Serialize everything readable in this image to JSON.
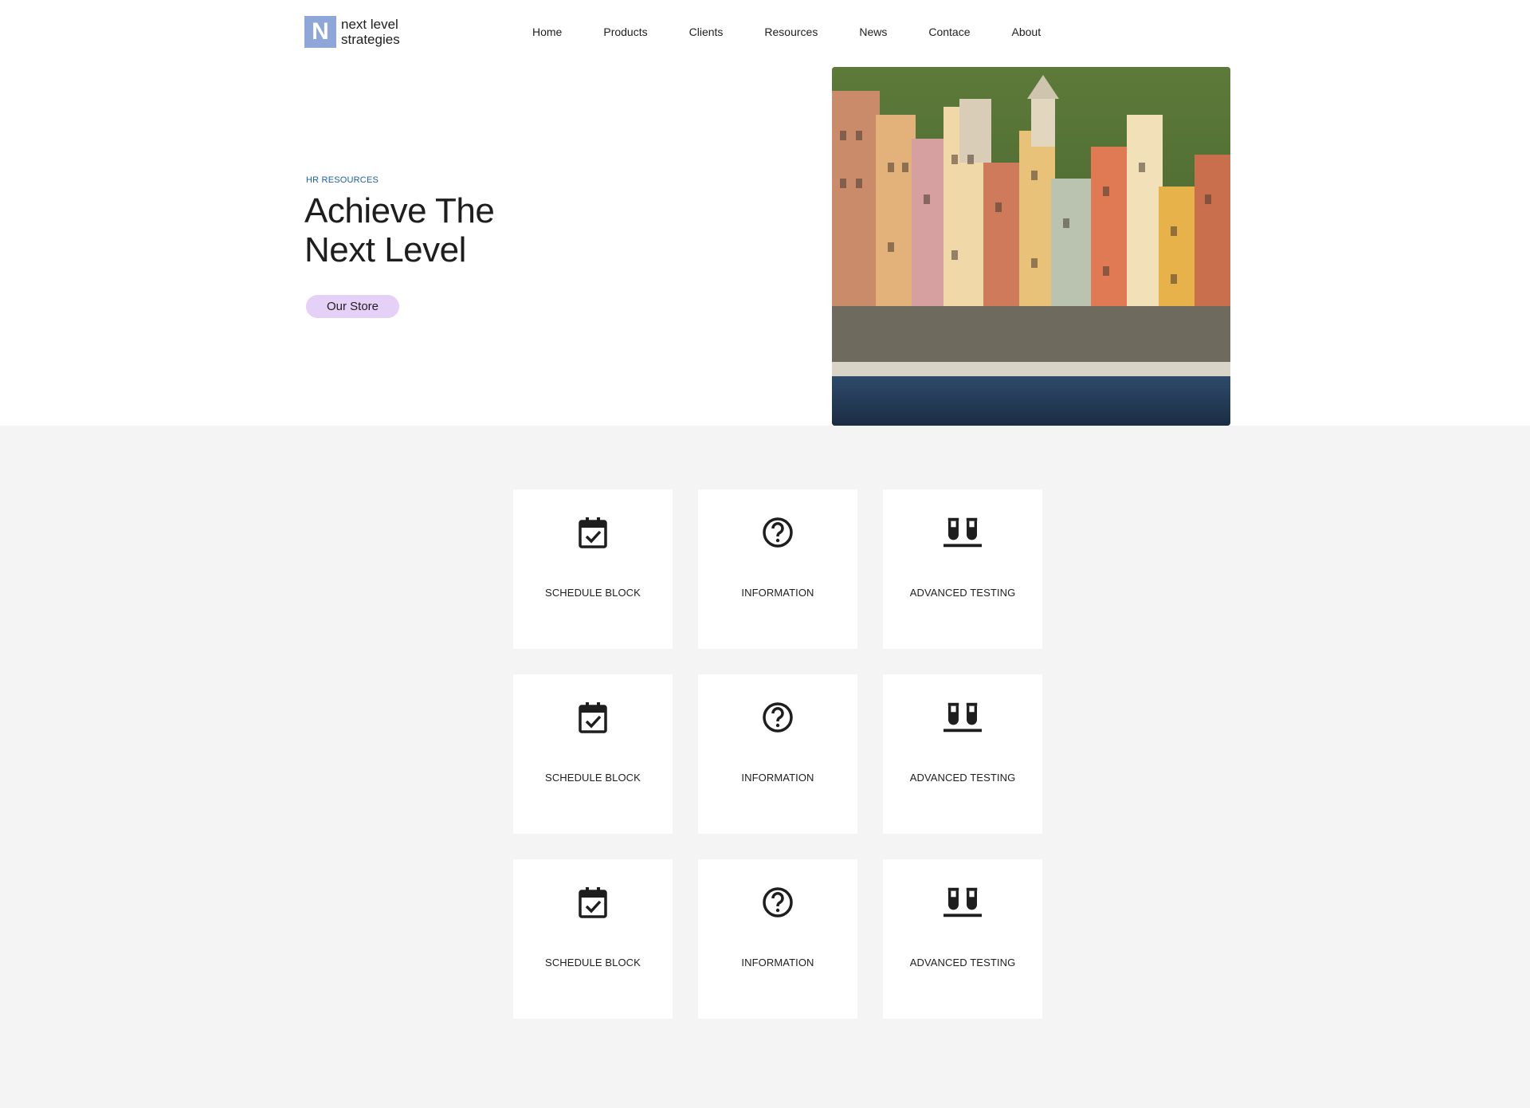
{
  "brand": {
    "line1": "next level",
    "line2": "strategies",
    "mark": "N",
    "accent": "#8ea6d8"
  },
  "nav": {
    "items": [
      {
        "label": "Home"
      },
      {
        "label": "Products"
      },
      {
        "label": "Clients"
      },
      {
        "label": "Resources"
      },
      {
        "label": "News"
      },
      {
        "label": "Contace"
      },
      {
        "label": "About"
      }
    ]
  },
  "hero": {
    "eyebrow": "HR RESOURCES",
    "title_line1": "Achieve The",
    "title_line2": "Next Level",
    "button_label": "Our Store",
    "button_color": "#e5d1f7",
    "image": "coastal-village-photo"
  },
  "features": {
    "cards": [
      {
        "label": "SCHEDULE BLOCK",
        "icon": "calendar-check-icon"
      },
      {
        "label": "INFORMATION",
        "icon": "question-circle-icon"
      },
      {
        "label": "ADVANCED TESTING",
        "icon": "test-tubes-icon"
      },
      {
        "label": "SCHEDULE BLOCK",
        "icon": "calendar-check-icon"
      },
      {
        "label": "INFORMATION",
        "icon": "question-circle-icon"
      },
      {
        "label": "ADVANCED TESTING",
        "icon": "test-tubes-icon"
      },
      {
        "label": "SCHEDULE BLOCK",
        "icon": "calendar-check-icon"
      },
      {
        "label": "INFORMATION",
        "icon": "question-circle-icon"
      },
      {
        "label": "ADVANCED TESTING",
        "icon": "test-tubes-icon"
      }
    ]
  }
}
